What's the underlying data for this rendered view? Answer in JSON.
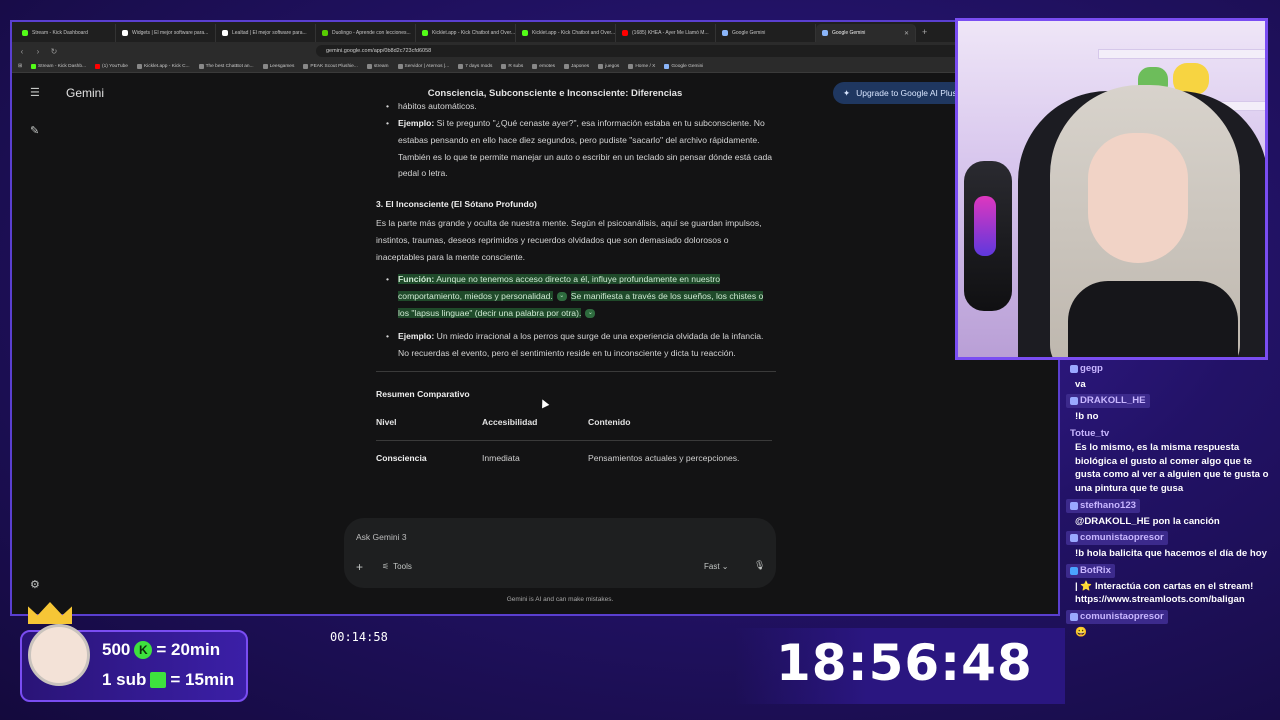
{
  "browser": {
    "tabs": [
      {
        "label": "Stream - Kick Dashboard",
        "color": "#53fc18"
      },
      {
        "label": "Widgets | El mejor software para...",
        "color": "#ffffff"
      },
      {
        "label": "Lealtad | El mejor software para...",
        "color": "#ffffff"
      },
      {
        "label": "Duolingo - Aprende con lecciones...",
        "color": "#58cc02"
      },
      {
        "label": "Kicklet.app - Kick Chatbot and Over...",
        "color": "#53fc18"
      },
      {
        "label": "Kicklet.app - Kick Chatbot and Over...",
        "color": "#53fc18"
      },
      {
        "label": "(1685) KHEA - Ayer Me Llamó M...",
        "color": "#ff0000"
      },
      {
        "label": "Google Gemini",
        "color": "#8ab4f8"
      },
      {
        "label": "Google Gemini",
        "color": "#8ab4f8"
      }
    ],
    "url": "gemini.google.com/app/0b8d2c723cfd6058",
    "bookmarks": [
      "Stream - Kick Dashb...",
      "(1) YouTube",
      "Kicklet.app - Kick C...",
      "The best ChatBot an...",
      "Leesgames",
      "PEAK Scout Plushie...",
      "stream",
      "Servidor | Aternos |...",
      "7 days mods",
      "R subs",
      "emotes",
      "Japones",
      "juegos",
      "Home / X",
      "Google Gemini"
    ]
  },
  "gemini": {
    "brand": "Gemini",
    "title": "Consciencia, Subconsciente e Inconsciente: Diferencias",
    "upgrade_label": "Upgrade to Google AI Plus",
    "content": {
      "p0": "hábitos automáticos.",
      "ex1_label": "Ejemplo:",
      "ex1_text": " Si te pregunto \"¿Qué cenaste ayer?\", esa información estaba en tu subconsciente. No estabas pensando en ello hace diez segundos, pero pudiste \"sacarlo\" del archivo rápidamente. También es lo que te permite manejar un auto o escribir en un teclado sin pensar dónde está cada pedal o letra.",
      "h3": "3. El Inconsciente (El Sótano Profundo)",
      "p3": "Es la parte más grande y oculta de nuestra mente. Según el psicoanálisis, aquí se guardan impulsos, instintos, traumas, deseos reprimidos y recuerdos olvidados que son demasiado dolorosos o inaceptables para la mente consciente.",
      "func_label": "Función:",
      "func_text1": " Aunque no tenemos acceso directo a él, influye profundamente en nuestro comportamiento, miedos y personalidad.",
      "func_text2": "Se manifiesta a través de los sueños, los chistes o los \"lapsus linguae\" (decir una palabra por otra).",
      "ex3_label": "Ejemplo:",
      "ex3_text": " Un miedo irracional a los perros que surge de una experiencia olvidada de la infancia. No recuerdas el evento, pero el sentimiento reside en tu inconsciente y dicta tu reacción.",
      "summary_title": "Resumen Comparativo",
      "table_headers": [
        "Nivel",
        "Accesibilidad",
        "Contenido"
      ],
      "table_row": [
        "Consciencia",
        "Inmediata",
        "Pensamientos actuales y percepciones."
      ]
    },
    "composer": {
      "placeholder": "Ask Gemini 3",
      "tools_label": "Tools",
      "mode_label": "Fast"
    },
    "disclaimer": "Gemini is AI and can make mistakes."
  },
  "chat": [
    {
      "user": "gegp",
      "text": "va",
      "color": "#c8b6ff"
    },
    {
      "user": "DRAKOLL_HE",
      "text": "!b no",
      "color": "#c8b6ff"
    },
    {
      "user": "Totue_tv",
      "text": "Es lo mismo, es la misma respuesta biológica el gusto al comer algo que te gusta como al ver a alguien que te gusta o una pintura que te gusa",
      "color": "#c8b6ff"
    },
    {
      "user": "stefhano123",
      "text": "@DRAKOLL_HE pon la canción",
      "color": "#c8b6ff"
    },
    {
      "user": "comunistaopresor",
      "text": "!b hola balicita que hacemos el día de hoy",
      "color": "#c8b6ff"
    },
    {
      "user": "BotRix",
      "text": "| ⭐ Interactúa con cartas en el stream! https://www.streamloots.com/baligan",
      "color": "#c8b6ff"
    },
    {
      "user": "comunistaopresor",
      "text": "😀",
      "color": "#c8b6ff"
    }
  ],
  "overlay": {
    "goal_line1_amount": "500",
    "goal_line1_rest": "= 20min",
    "goal_line2_amount": "1 sub",
    "goal_line2_rest": "= 15min",
    "elapsed": "00:14:58",
    "clock": "18:56:48"
  }
}
